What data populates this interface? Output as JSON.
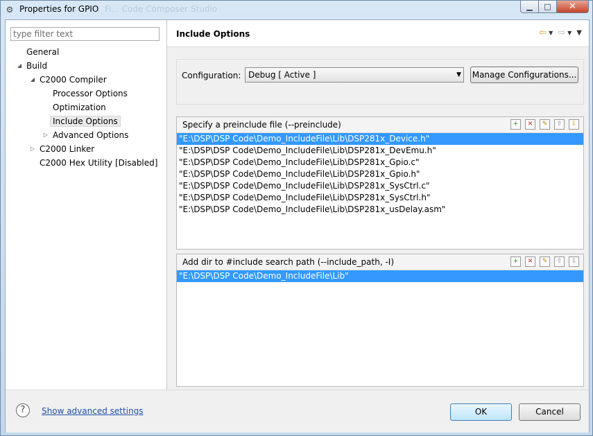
{
  "window": {
    "title": "Properties for GPIO",
    "ghost_title": "Fi... Code Composer Studio"
  },
  "filter": {
    "placeholder": "type filter text"
  },
  "tree": [
    {
      "label": "General"
    },
    {
      "label": "Build",
      "arrow": "◢"
    },
    {
      "label": "C2000 Compiler",
      "arrow": "◢"
    },
    {
      "label": "Processor Options"
    },
    {
      "label": "Optimization"
    },
    {
      "label": "Include Options",
      "selected": true
    },
    {
      "label": "Advanced Options",
      "arrow": "▷"
    },
    {
      "label": "C2000 Linker",
      "arrow": "▷"
    },
    {
      "label": "C2000 Hex Utility  [Disabled]"
    }
  ],
  "page": {
    "title": "Include Options"
  },
  "config": {
    "label": "Configuration:",
    "value": "Debug  [ Active ]",
    "manage": "Manage Configurations..."
  },
  "preinclude": {
    "title": "Specify a preinclude file (--preinclude)",
    "items": [
      "\"E:\\DSP\\DSP Code\\Demo_IncludeFile\\Lib\\DSP281x_Device.h\"",
      "\"E:\\DSP\\DSP Code\\Demo_IncludeFile\\Lib\\DSP281x_DevEmu.h\"",
      "\"E:\\DSP\\DSP Code\\Demo_IncludeFile\\Lib\\DSP281x_Gpio.c\"",
      "\"E:\\DSP\\DSP Code\\Demo_IncludeFile\\Lib\\DSP281x_Gpio.h\"",
      "\"E:\\DSP\\DSP Code\\Demo_IncludeFile\\Lib\\DSP281x_SysCtrl.c\"",
      "\"E:\\DSP\\DSP Code\\Demo_IncludeFile\\Lib\\DSP281x_SysCtrl.h\"",
      "\"E:\\DSP\\DSP Code\\Demo_IncludeFile\\Lib\\DSP281x_usDelay.asm\""
    ]
  },
  "include_path": {
    "title": "Add dir to #include search path (--include_path, -I)",
    "items": [
      "\"E:\\DSP\\DSP Code\\Demo_IncludeFile\\Lib\""
    ]
  },
  "footer": {
    "help": "?",
    "advanced": "Show advanced settings",
    "ok": "OK",
    "cancel": "Cancel"
  },
  "icons": {
    "app": "⚙",
    "back": "⇦",
    "forward": "⇨",
    "dropdown": "▼",
    "add": "+",
    "delete": "✕",
    "edit": "✎",
    "up": "⇧",
    "down": "⇩",
    "minimize": "▁",
    "maximize": "□",
    "close": "✕",
    "caret": "▼"
  },
  "colors": {
    "selection": "#3399ff",
    "link": "#1f4fa3",
    "ok_border": "#3c7fb1"
  }
}
